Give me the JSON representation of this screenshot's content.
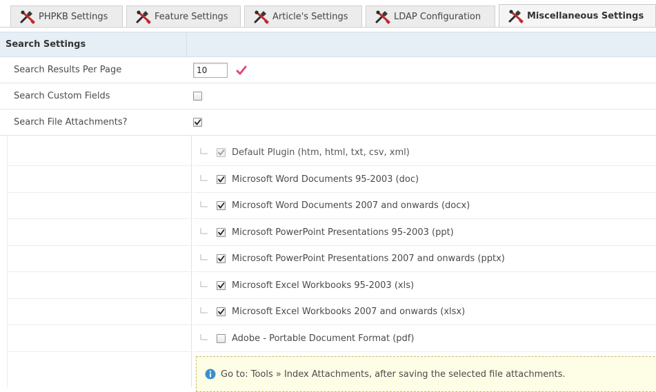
{
  "tabs": [
    {
      "label": "PHPKB Settings",
      "active": false
    },
    {
      "label": "Feature Settings",
      "active": false
    },
    {
      "label": "Article's Settings",
      "active": false
    },
    {
      "label": "LDAP Configuration",
      "active": false
    },
    {
      "label": "Miscellaneous Settings",
      "active": true
    }
  ],
  "section": {
    "title": "Search Settings"
  },
  "settings": {
    "results_per_page": {
      "label": "Search Results Per Page",
      "value": "10"
    },
    "custom_fields": {
      "label": "Search Custom Fields",
      "checked": false
    },
    "file_attachments": {
      "label": "Search File Attachments?",
      "checked": true
    }
  },
  "plugins": [
    {
      "label": "Default Plugin (htm, html, txt, csv, xml)",
      "checked": true,
      "disabled": true
    },
    {
      "label": "Microsoft Word Documents 95-2003 (doc)",
      "checked": true,
      "disabled": false
    },
    {
      "label": "Microsoft Word Documents 2007 and onwards (docx)",
      "checked": true,
      "disabled": false
    },
    {
      "label": "Microsoft PowerPoint Presentations 95-2003 (ppt)",
      "checked": true,
      "disabled": false
    },
    {
      "label": "Microsoft PowerPoint Presentations 2007 and onwards (pptx)",
      "checked": true,
      "disabled": false
    },
    {
      "label": "Microsoft Excel Workbooks 95-2003 (xls)",
      "checked": true,
      "disabled": false
    },
    {
      "label": "Microsoft Excel Workbooks 2007 and onwards (xlsx)",
      "checked": true,
      "disabled": false
    },
    {
      "label": "Adobe - Portable Document Format (pdf)",
      "checked": false,
      "disabled": false
    }
  ],
  "info": {
    "message": "Go to: Tools » Index Attachments, after saving the selected file attachments."
  },
  "colors": {
    "valid_check": "#e0457b",
    "info_icon": "#3a8fd0",
    "header_bg": "#e6eef6"
  }
}
